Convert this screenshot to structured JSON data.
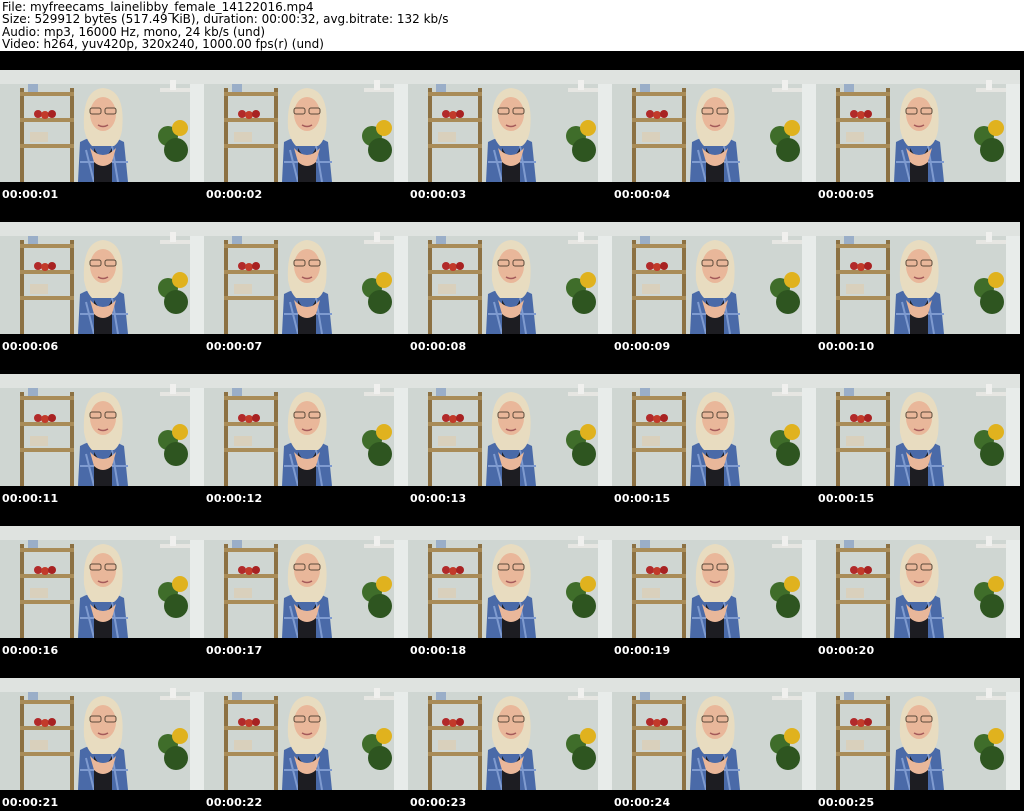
{
  "header": {
    "file": "File: myfreecams_lainelibby_female_14122016.mp4",
    "size": "Size: 529912 bytes (517.49 KiB), duration: 00:00:32, avg.bitrate: 132 kb/s",
    "audio": "Audio: mp3, 16000 Hz, mono, 24 kb/s (und)",
    "video": "Video: h264, yuv420p, 320x240, 1000.00 fps(r) (und)"
  },
  "thumbnails": [
    {
      "timestamp": "00:00:01"
    },
    {
      "timestamp": "00:00:02"
    },
    {
      "timestamp": "00:00:03"
    },
    {
      "timestamp": "00:00:04"
    },
    {
      "timestamp": "00:00:05"
    },
    {
      "timestamp": "00:00:06"
    },
    {
      "timestamp": "00:00:07"
    },
    {
      "timestamp": "00:00:08"
    },
    {
      "timestamp": "00:00:09"
    },
    {
      "timestamp": "00:00:10"
    },
    {
      "timestamp": "00:00:11"
    },
    {
      "timestamp": "00:00:12"
    },
    {
      "timestamp": "00:00:13"
    },
    {
      "timestamp": "00:00:15"
    },
    {
      "timestamp": "00:00:15"
    },
    {
      "timestamp": "00:00:16"
    },
    {
      "timestamp": "00:00:17"
    },
    {
      "timestamp": "00:00:18"
    },
    {
      "timestamp": "00:00:19"
    },
    {
      "timestamp": "00:00:20"
    },
    {
      "timestamp": "00:00:21"
    },
    {
      "timestamp": "00:00:22"
    },
    {
      "timestamp": "00:00:23"
    },
    {
      "timestamp": "00:00:24"
    },
    {
      "timestamp": "00:00:25"
    }
  ],
  "colors": {
    "background": "#ffffff",
    "grid_background": "#000000",
    "timestamp_text": "#ffffff",
    "wall": "#cfd6d2",
    "shelf": "#a98c58",
    "shirt": "#4a6aa8",
    "hair": "#e8dcc0",
    "skin": "#e9b79a"
  }
}
